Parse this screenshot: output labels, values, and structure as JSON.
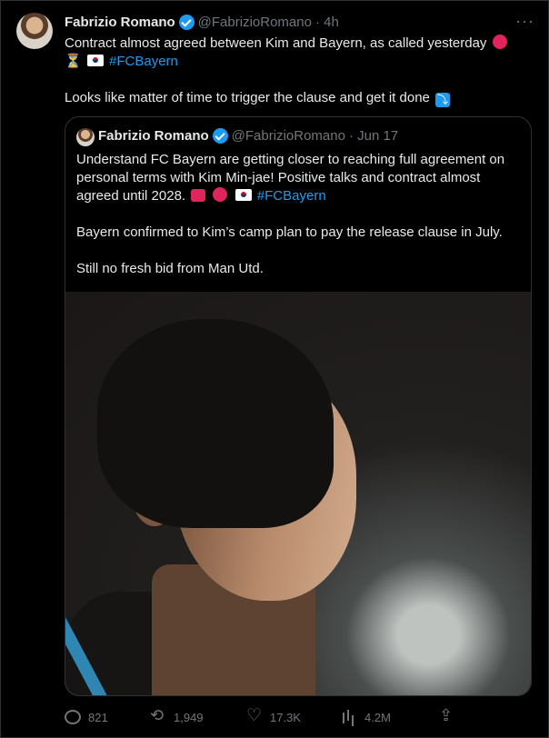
{
  "tweet": {
    "author_name": "Fabrizio Romano",
    "handle": "@FabrizioRomano",
    "time": "· 4h",
    "more": "···",
    "line1": "Contract almost agreed between Kim and Bayern, as called yesterday",
    "hashtag": "#FCBayern",
    "line2": "Looks like matter of time to trigger the clause and get it done"
  },
  "quote": {
    "author_name": "Fabrizio Romano",
    "handle": "@FabrizioRomano",
    "time": "· Jun 17",
    "p1": "Understand FC Bayern are getting closer to reaching full agreement on personal terms with Kim Min-jae! Positive talks and contract almost agreed until 2028.",
    "hashtag": "#FCBayern",
    "p2": "Bayern confirmed to Kim’s camp plan to pay the release clause in July.",
    "p3": "Still no fresh bid from Man Utd."
  },
  "actions": {
    "replies": "821",
    "retweets": "1,949",
    "likes": "17.3K",
    "views": "4.2M"
  },
  "icons": [
    "verified-badge-icon",
    "more-icon",
    "red-circle-emoji",
    "hourglass-emoji",
    "korea-flag-emoji",
    "arrow-down-emoji",
    "siren-emoji",
    "reply-icon",
    "retweet-icon",
    "like-icon",
    "views-icon",
    "share-icon"
  ],
  "colors": {
    "background": "#000000",
    "text": "#e7e9ea",
    "muted": "#71767b",
    "accent": "#1d9bf0",
    "border": "#2f3336"
  }
}
